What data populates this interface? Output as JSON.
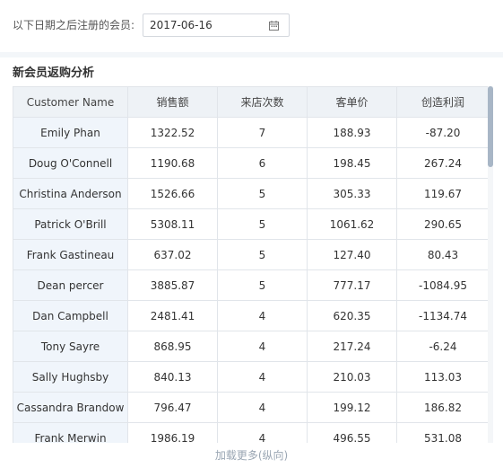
{
  "filter": {
    "label": "以下日期之后注册的会员:",
    "date_value": "2017-06-16",
    "icon": "calendar-icon"
  },
  "panel": {
    "title": "新会员返购分析",
    "columns": [
      "Customer Name",
      "销售额",
      "来店次数",
      "客单价",
      "创造利润"
    ],
    "rows": [
      [
        "Emily Phan",
        "1322.52",
        "7",
        "188.93",
        "-87.20"
      ],
      [
        "Doug O'Connell",
        "1190.68",
        "6",
        "198.45",
        "267.24"
      ],
      [
        "Christina Anderson",
        "1526.66",
        "5",
        "305.33",
        "119.67"
      ],
      [
        "Patrick O'Brill",
        "5308.11",
        "5",
        "1061.62",
        "290.65"
      ],
      [
        "Frank Gastineau",
        "637.02",
        "5",
        "127.40",
        "80.43"
      ],
      [
        "Dean percer",
        "3885.87",
        "5",
        "777.17",
        "-1084.95"
      ],
      [
        "Dan Campbell",
        "2481.41",
        "4",
        "620.35",
        "-1134.74"
      ],
      [
        "Tony Sayre",
        "868.95",
        "4",
        "217.24",
        "-6.24"
      ],
      [
        "Sally Hughsby",
        "840.13",
        "4",
        "210.03",
        "113.03"
      ],
      [
        "Cassandra Brandow",
        "796.47",
        "4",
        "199.12",
        "186.82"
      ],
      [
        "Frank Merwin",
        "1986.19",
        "4",
        "496.55",
        "531.08"
      ]
    ],
    "load_more": "加载更多(纵向)"
  },
  "colors": {
    "header_bg": "#eef2f6",
    "name_column_bg": "#f0f5fb",
    "scroll_thumb": "#a8b6c6"
  }
}
